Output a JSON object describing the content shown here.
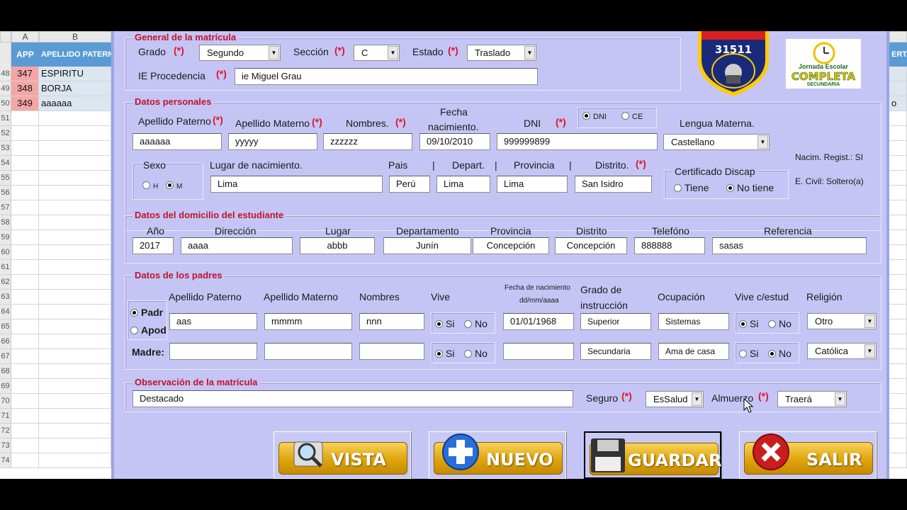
{
  "sheet": {
    "col_a": "A",
    "col_b": "B",
    "col_right": "",
    "hdr_app": "APP",
    "hdr_apellido": "APELLIDO PATERN",
    "hdr_right": "ERT.",
    "rows": [
      {
        "n": "48",
        "app": "347",
        "ap": "ESPIRITU",
        "r": ""
      },
      {
        "n": "49",
        "app": "348",
        "ap": "BORJA",
        "r": ""
      },
      {
        "n": "50",
        "app": "349",
        "ap": "aaaaaa",
        "r": "o"
      },
      {
        "n": "51"
      },
      {
        "n": "52"
      },
      {
        "n": "53"
      },
      {
        "n": "54"
      },
      {
        "n": "55"
      },
      {
        "n": "56"
      },
      {
        "n": "57"
      },
      {
        "n": "58"
      },
      {
        "n": "59"
      },
      {
        "n": "60"
      },
      {
        "n": "61"
      },
      {
        "n": "62"
      },
      {
        "n": "63"
      },
      {
        "n": "64"
      },
      {
        "n": "65"
      },
      {
        "n": "66"
      },
      {
        "n": "67"
      },
      {
        "n": "68"
      },
      {
        "n": "69"
      },
      {
        "n": "70"
      },
      {
        "n": "71"
      },
      {
        "n": "72"
      },
      {
        "n": "73"
      },
      {
        "n": "74"
      }
    ]
  },
  "general": {
    "title": "General de la matrícula",
    "grado_label": "Grado",
    "grado_value": "Segundo",
    "seccion_label": "Sección",
    "seccion_value": "C",
    "estado_label": "Estado",
    "estado_value": "Traslado",
    "ie_label": "IE Procedencia",
    "ie_value": "ie Miguel Grau",
    "req": "(*)"
  },
  "logos": {
    "school_number": "31511",
    "jornada_line1": "Jornada Escolar",
    "jornada_line2": "COMPLETA",
    "jornada_line3": "SECUNDARIA"
  },
  "personal": {
    "title": "Datos personales",
    "ap_pat_label": "Apellido Paterno",
    "ap_pat_value": "aaaaaa",
    "ap_mat_label": "Apellido Materno",
    "ap_mat_value": "yyyyy",
    "nombres_label": "Nombres.",
    "nombres_value": "zzzzzz",
    "fecha_label1": "Fecha",
    "fecha_label2": "nacimiento.",
    "fecha_value": "09/10/2010",
    "dni_label": "DNI",
    "dni_value": "999999899",
    "doc_dni": "DNI",
    "doc_ce": "CE",
    "lengua_label": "Lengua Materna.",
    "lengua_value": "Castellano",
    "nacim_regist": "Nacim. Regist.: SI",
    "estado_civil": "E. Civil: Soltero(a)",
    "sexo_label": "Sexo",
    "sexo_h": "H",
    "sexo_m": "M",
    "lugar_label": "Lugar de nacimiento.",
    "lugar_value": "Lima",
    "pais_label": "Pais",
    "pais_value": "Perú",
    "depart_label": "Depart.",
    "depart_value": "Lima",
    "provincia_label": "Provincia",
    "provincia_value": "Lima",
    "distrito_label": "Distrito.",
    "distrito_value": "San Isidro",
    "sep": "|",
    "cert_label": "Certificado Discap",
    "cert_tiene": "Tiene",
    "cert_notiene": "No tiene"
  },
  "domicilio": {
    "title": "Datos del domicilio del estudiante",
    "anio_label": "Año",
    "anio_value": "2017",
    "direccion_label": "Dirección",
    "direccion_value": "aaaa",
    "lugar_label": "Lugar",
    "lugar_value": "abbb",
    "departamento_label": "Departamento",
    "departamento_value": "Junín",
    "provincia_label": "Provincia",
    "provincia_value": "Concepción",
    "distrito_label": "Distrito",
    "distrito_value": "Concepción",
    "telefono_label": "Telefóno",
    "telefono_value": "888888",
    "referencia_label": "Referencia",
    "referencia_value": "sasas"
  },
  "padres": {
    "title": "Datos de los padres",
    "ap_pat_label": "Apellido Paterno",
    "ap_mat_label": "Apellido Materno",
    "nombres_label": "Nombres",
    "vive_label": "Vive",
    "fecha_label1": "Fecha de nacimiento",
    "fecha_label2": "dd/mm/aaaa",
    "grado_label1": "Grado de",
    "grado_label2": "instrucción",
    "ocupacion_label": "Ocupación",
    "vive_estud_label": "Vive c/estud",
    "religion_label": "Religión",
    "padr": "Padr",
    "apod": "Apod",
    "madre_label": "Madre:",
    "si": "Si",
    "no": "No",
    "padre": {
      "ap_pat": "aas",
      "ap_mat": "mmmm",
      "nombres": "nnn",
      "fecha": "01/01/1968",
      "grado": "Superior",
      "ocupacion": "Sistemas",
      "religion": "Otro"
    },
    "madre": {
      "ap_pat": "",
      "ap_mat": "",
      "nombres": "",
      "fecha": "",
      "grado": "Secundaria",
      "ocupacion": "Ama de casa",
      "religion": "Católica"
    }
  },
  "observacion": {
    "title": "Observación de la matrícula",
    "value": "Destacado",
    "seguro_label": "Seguro",
    "seguro_value": "EsSalud",
    "almuerzo_label": "Almuerzo",
    "almuerzo_value": "Traerá"
  },
  "buttons": {
    "vista": "VISTA",
    "nuevo": "NUEVO",
    "guardar": "GUARDAR",
    "salir": "SALIR"
  },
  "colors": {
    "form_bg": "#c5c5f5",
    "section_title": "#c0142a",
    "required": "#e0142a",
    "button_gold": "#e0a40c"
  }
}
